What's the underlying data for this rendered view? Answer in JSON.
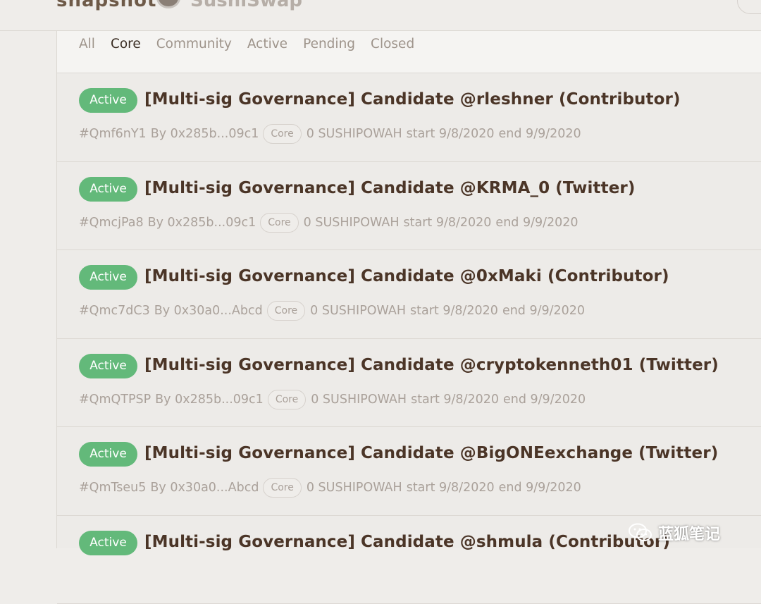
{
  "header": {
    "brand_fragment": "snapshot",
    "space_fragment": "SushiSwap"
  },
  "tabs": [
    {
      "label": "All"
    },
    {
      "label": "Core",
      "active": true
    },
    {
      "label": "Community"
    },
    {
      "label": "Active"
    },
    {
      "label": "Pending"
    },
    {
      "label": "Closed"
    }
  ],
  "proposals": [
    {
      "status": "Active",
      "title": "[Multi-sig Governance] Candidate @rleshner (Contributor)",
      "id": "#Qmf6nY1",
      "by": "By 0x285b...09c1",
      "tag": "Core",
      "votes": "0 SUSHIPOWAH",
      "start": "start 9/8/2020",
      "end": "end 9/9/2020"
    },
    {
      "status": "Active",
      "title": "[Multi-sig Governance] Candidate @KRMA_0 (Twitter)",
      "id": "#QmcjPa8",
      "by": "By 0x285b...09c1",
      "tag": "Core",
      "votes": "0 SUSHIPOWAH",
      "start": "start 9/8/2020",
      "end": "end 9/9/2020"
    },
    {
      "status": "Active",
      "title": "[Multi-sig Governance] Candidate @0xMaki (Contributor)",
      "id": "#Qmc7dC3",
      "by": "By 0x30a0...Abcd",
      "tag": "Core",
      "votes": "0 SUSHIPOWAH",
      "start": "start 9/8/2020",
      "end": "end 9/9/2020"
    },
    {
      "status": "Active",
      "title": "[Multi-sig Governance] Candidate @cryptokenneth01 (Twitter)",
      "id": "#QmQTPSP",
      "by": "By 0x285b...09c1",
      "tag": "Core",
      "votes": "0 SUSHIPOWAH",
      "start": "start 9/8/2020",
      "end": "end 9/9/2020"
    },
    {
      "status": "Active",
      "title": "[Multi-sig Governance] Candidate @BigONEexchange (Twitter)",
      "id": "#QmTseu5",
      "by": "By 0x30a0...Abcd",
      "tag": "Core",
      "votes": "0 SUSHIPOWAH",
      "start": "start 9/8/2020",
      "end": "end 9/9/2020"
    },
    {
      "status": "Active",
      "title": "[Multi-sig Governance] Candidate @shmula (Contributor)",
      "id": "",
      "by": "",
      "tag": "",
      "votes": "",
      "start": "",
      "end": ""
    }
  ],
  "watermark": {
    "text": "蓝狐笔记",
    "icon": "wechat-icon"
  },
  "colors": {
    "active_badge": "#63b97a",
    "title": "#4b3527",
    "meta": "#aaa19a"
  }
}
